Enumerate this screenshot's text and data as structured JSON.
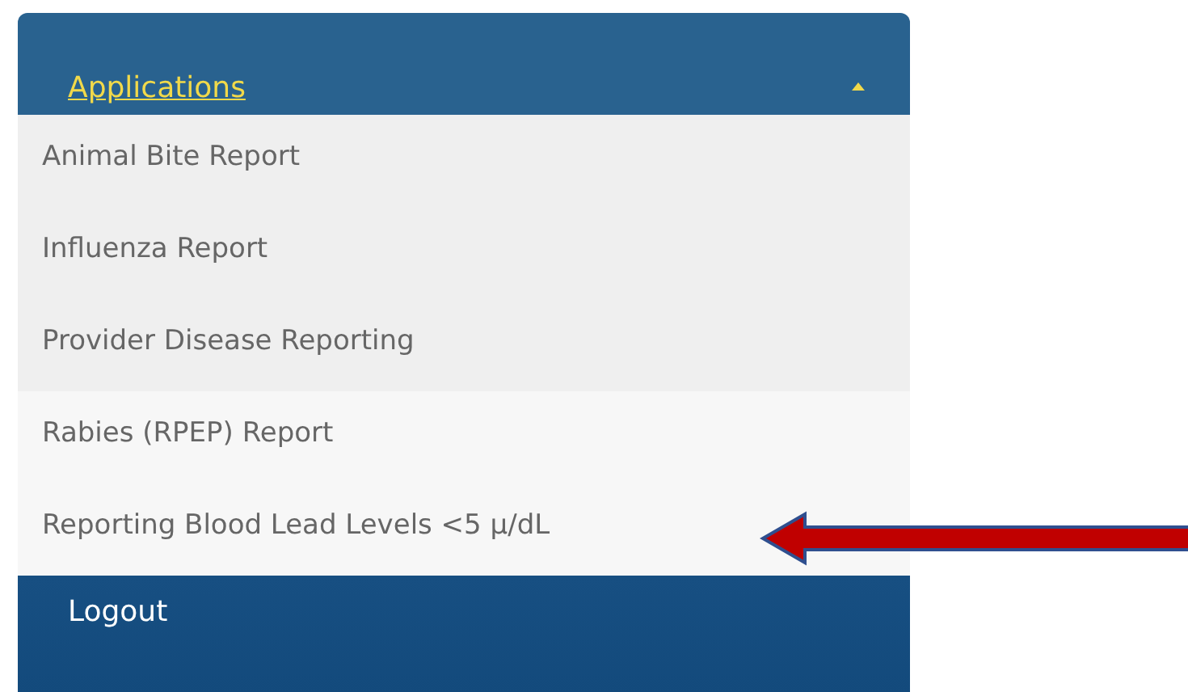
{
  "menu": {
    "header": {
      "label": "Applications",
      "expanded": true
    },
    "items": [
      {
        "label": "Animal Bite Report",
        "shaded": true
      },
      {
        "label": "Influenza Report",
        "shaded": true
      },
      {
        "label": "Provider Disease Reporting",
        "shaded": true
      },
      {
        "label": "Rabies (RPEP) Report",
        "shaded": false
      },
      {
        "label": "Reporting Blood Lead Levels <5 μ/dL",
        "shaded": false
      }
    ],
    "footer": {
      "label": "Logout"
    }
  }
}
